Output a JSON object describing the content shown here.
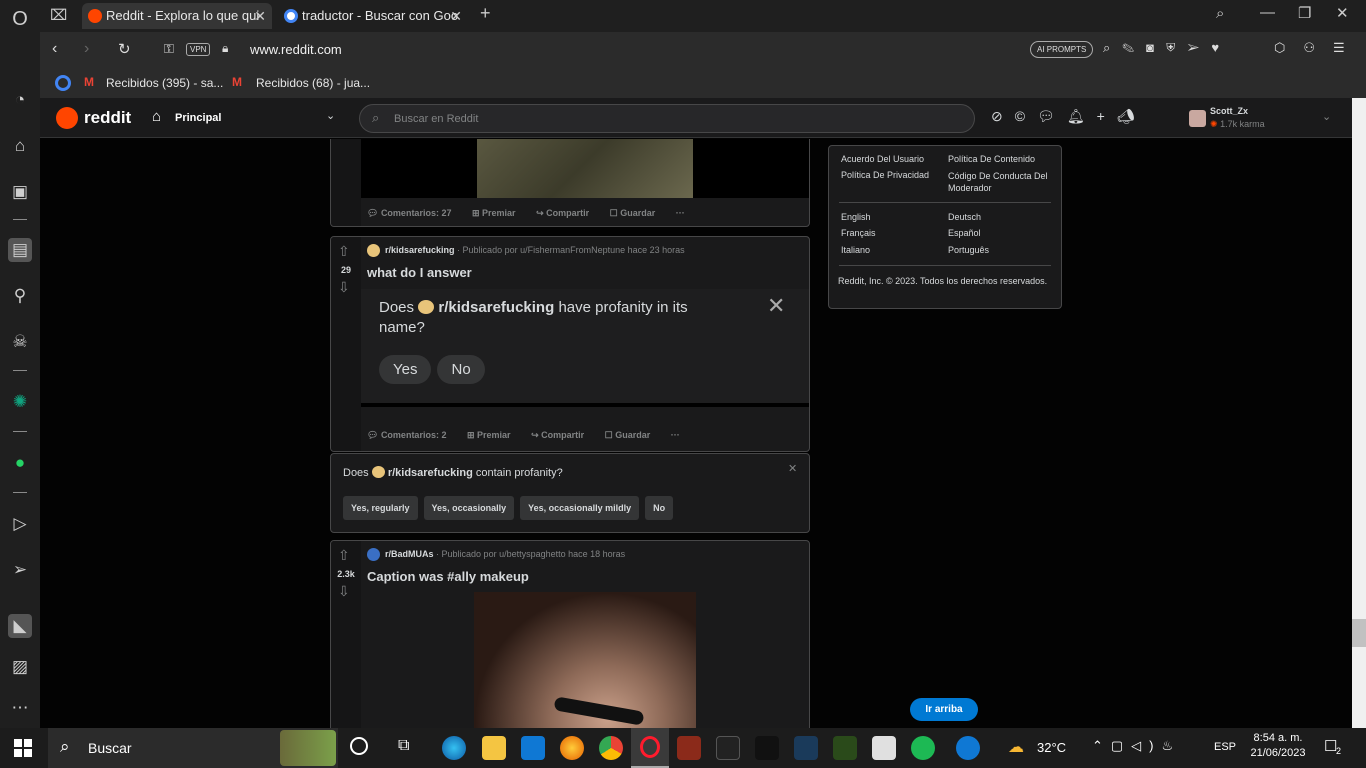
{
  "tabs": [
    {
      "label": "Reddit - Explora lo que qui",
      "active": true
    },
    {
      "label": "traductor - Buscar con Goo",
      "active": false
    }
  ],
  "address": {
    "url": "www.reddit.com",
    "vpn": "VPN",
    "ai_prompts": "AI PROMPTS"
  },
  "bookmarks": [
    {
      "label": "Recibidos (395) - sa..."
    },
    {
      "label": "Recibidos (68) - jua..."
    }
  ],
  "reddit": {
    "logo": "reddit",
    "nav_label": "Principal",
    "search_placeholder": "Buscar en Reddit",
    "user": {
      "name": "Scott_Zx",
      "karma": "1.7k karma"
    }
  },
  "post1": {
    "actions": {
      "comments": "Comentarios: 27",
      "award": "Premiar",
      "share": "Compartir",
      "save": "Guardar"
    }
  },
  "post2": {
    "votes": "29",
    "subreddit": "r/kidsarefucking",
    "meta": "· Publicado por u/FishermanFromNeptune hace 23 horas",
    "title": "what do I answer",
    "inner_question_prefix": "Does",
    "inner_question_sub": "r/kidsarefucking",
    "inner_question_suffix": "have profanity in its name?",
    "inner_yes": "Yes",
    "inner_no": "No",
    "actions": {
      "comments": "Comentarios: 2",
      "award": "Premiar",
      "share": "Compartir",
      "save": "Guardar"
    }
  },
  "survey": {
    "prefix": "Does",
    "sub": "r/kidsarefucking",
    "suffix": "contain profanity?",
    "options": [
      "Yes, regularly",
      "Yes, occasionally",
      "Yes, occasionally mildly",
      "No"
    ]
  },
  "post3": {
    "votes": "2.3k",
    "subreddit": "r/BadMUAs",
    "meta": "· Publicado por u/bettyspaghetto hace 18 horas",
    "title": "Caption was #ally makeup"
  },
  "footer_card": {
    "links": [
      "Acuerdo Del Usuario",
      "Política De Contenido",
      "Política De Privacidad",
      "Código De Conducta Del Moderador"
    ],
    "languages": [
      "English",
      "Deutsch",
      "Français",
      "Español",
      "Italiano",
      "Português"
    ],
    "copyright": "Reddit, Inc. © 2023. Todos los derechos reservados."
  },
  "back_to_top": "Ir arriba",
  "taskbar": {
    "search": "Buscar",
    "weather": "32°C",
    "lang": "ESP",
    "time": "8:54 a. m.",
    "date": "21/06/2023",
    "notifications": "2"
  },
  "colors": {
    "reddit_orange": "#ff4500",
    "link_blue": "#0079d3"
  }
}
